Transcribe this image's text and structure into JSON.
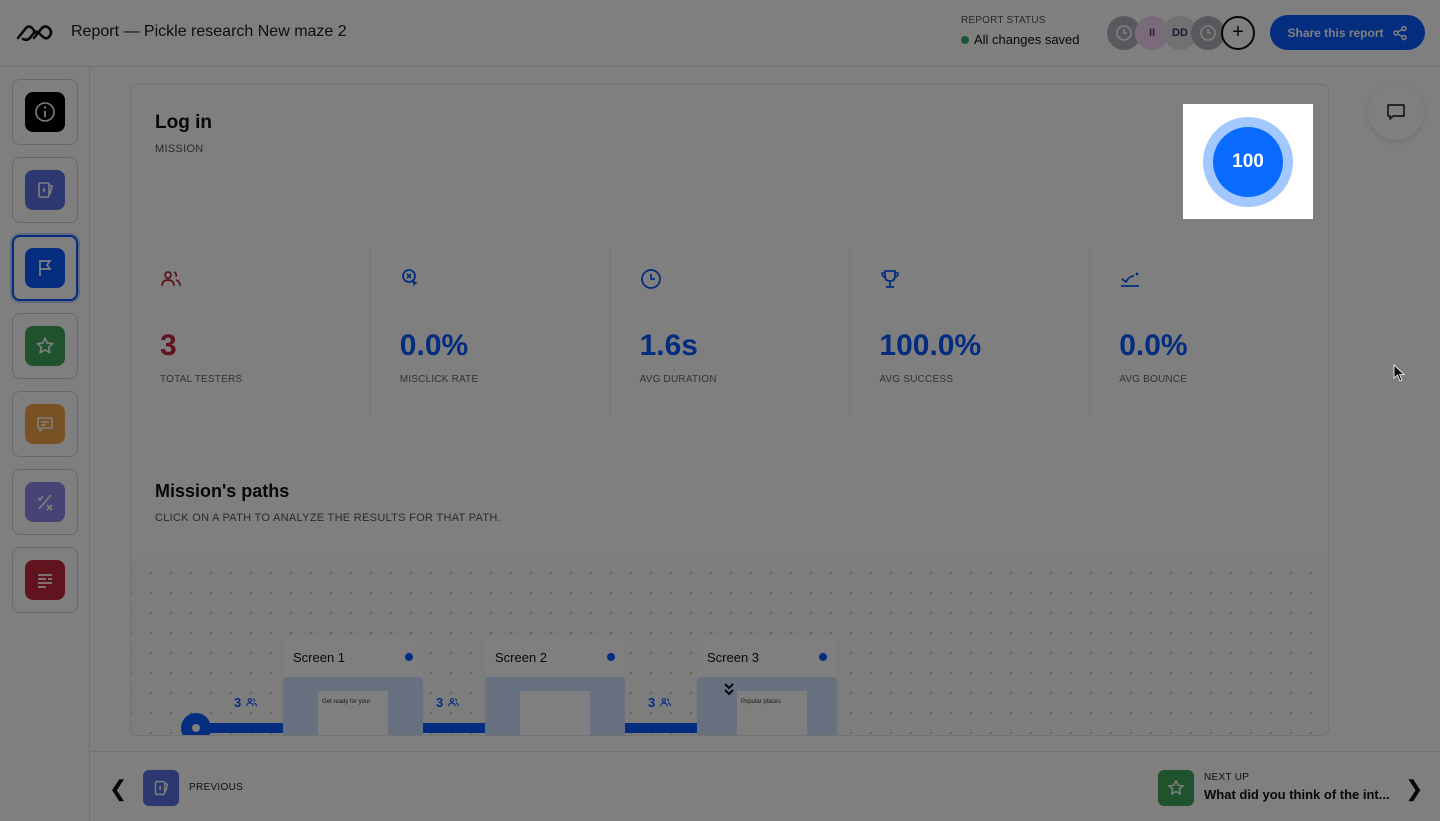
{
  "header": {
    "title": "Report — Pickle research New maze 2",
    "status_label": "REPORT STATUS",
    "status_value": "All changes saved",
    "status_color": "#2fb36a",
    "avatars": [
      {
        "type": "icon",
        "icon": "clock-icon"
      },
      {
        "type": "initials",
        "text": "II"
      },
      {
        "type": "initials",
        "text": "DD"
      },
      {
        "type": "icon",
        "icon": "clock-icon"
      }
    ],
    "add_collaborator_label": "+",
    "share_label": "Share this report"
  },
  "sidebar": {
    "items": [
      {
        "name": "info",
        "icon": "info-icon",
        "color": "#000000",
        "active": false
      },
      {
        "name": "opinion-scale",
        "icon": "card-icon",
        "color": "#5b6fe0",
        "active": false
      },
      {
        "name": "mission",
        "icon": "flag-icon",
        "color": "#0a5bff",
        "active": true
      },
      {
        "name": "rating",
        "icon": "star-icon",
        "color": "#3fa45a",
        "active": false
      },
      {
        "name": "open-question",
        "icon": "message-icon",
        "color": "#f0a24a",
        "active": false
      },
      {
        "name": "yes-no",
        "icon": "check-x-icon",
        "color": "#8f86e8",
        "active": false
      },
      {
        "name": "context",
        "icon": "text-lines-icon",
        "color": "#c2273d",
        "active": false
      }
    ]
  },
  "mission": {
    "title": "Log in",
    "subtitle": "MISSION",
    "score": "100",
    "stats": [
      {
        "icon": "users-icon",
        "value": "3",
        "label": "TOTAL TESTERS",
        "color": "#c2273d"
      },
      {
        "icon": "misclick-icon",
        "value": "0.0%",
        "label": "MISCLICK RATE",
        "color": "#0a5bff"
      },
      {
        "icon": "clock-icon",
        "value": "1.6s",
        "label": "AVG DURATION",
        "color": "#0a5bff"
      },
      {
        "icon": "trophy-icon",
        "value": "100.0%",
        "label": "AVG SUCCESS",
        "color": "#0a5bff"
      },
      {
        "icon": "bounce-icon",
        "value": "0.0%",
        "label": "AVG BOUNCE",
        "color": "#0a5bff"
      }
    ]
  },
  "paths": {
    "title": "Mission's paths",
    "subtitle": "CLICK ON A PATH TO ANALYZE THE RESULTS FOR THAT PATH.",
    "counts": [
      "3",
      "3",
      "3"
    ],
    "screens": [
      {
        "label": "Screen 1",
        "thumb_text": "Get ready for your"
      },
      {
        "label": "Screen 2",
        "thumb_text": ""
      },
      {
        "label": "Screen 3",
        "thumb_text": "Popular places"
      }
    ]
  },
  "footer": {
    "previous_label": "PREVIOUS",
    "next_label": "NEXT UP",
    "next_title": "What did you think of the int..."
  }
}
